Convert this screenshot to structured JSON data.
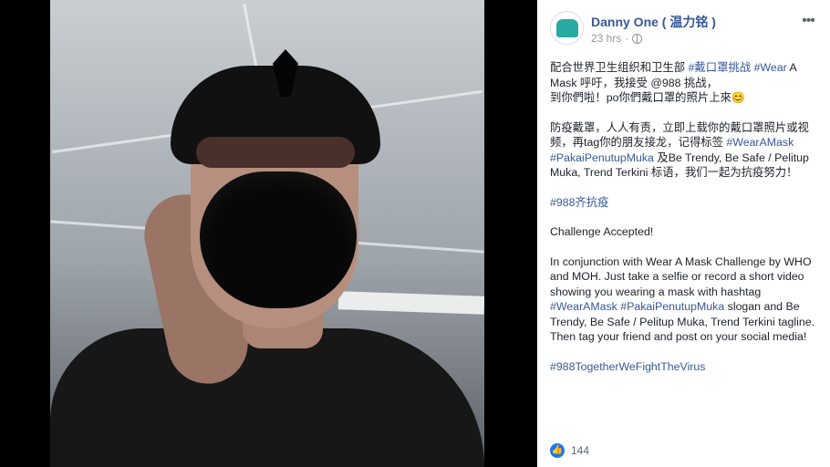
{
  "post": {
    "author": "Danny One ( 温力铭 )",
    "time": "23 hrs",
    "line1_plain": "配合世界卫生组织和卫生部 ",
    "line1_tag1": "#戴口罩挑战",
    "line1_space": " ",
    "line1_tag2": "#Wear",
    "line1_rest": " A Mask 呼吁，我接受 @988 挑战，",
    "line2": "到你們啦！po你們戴口罩的照片上來😊",
    "para2_a": "防疫戴罩，人人有责，立即上载你的戴口罩照片或视频，再tag你的朋友接龙，记得标签 ",
    "para2_tag1": "#WearAMask",
    "para2_space": " ",
    "para2_tag2": "#PakaiPenutupMuka",
    "para2_b": " 及Be Trendy, Be Safe / Pelitup Muka, Trend Terkini 标语，我们一起为抗疫努力！",
    "tag_fight": "#988齐抗疫",
    "challenge": "Challenge Accepted!",
    "english_a": "In conjunction with Wear A Mask Challenge by WHO and MOH. Just take a selfie or record a short video showing you wearing a mask with hashtag ",
    "english_tag1": "#WearAMask",
    "english_space": " ",
    "english_tag2": "#PakaiPenutupMuka",
    "english_b": " slogan and Be Trendy, Be Safe / Pelitup Muka, Trend Terkini tagline. Then tag your friend and post on your social media!",
    "final_tag": "#988TogetherWeFightTheVirus"
  },
  "reactions": {
    "count": "144"
  },
  "icons": {
    "globe": "globe-icon",
    "more": "more-icon",
    "like": "like-icon",
    "avatar": "avatar"
  },
  "colors": {
    "link": "#365899",
    "panel": "#ffffff",
    "viewer": "#000000"
  }
}
